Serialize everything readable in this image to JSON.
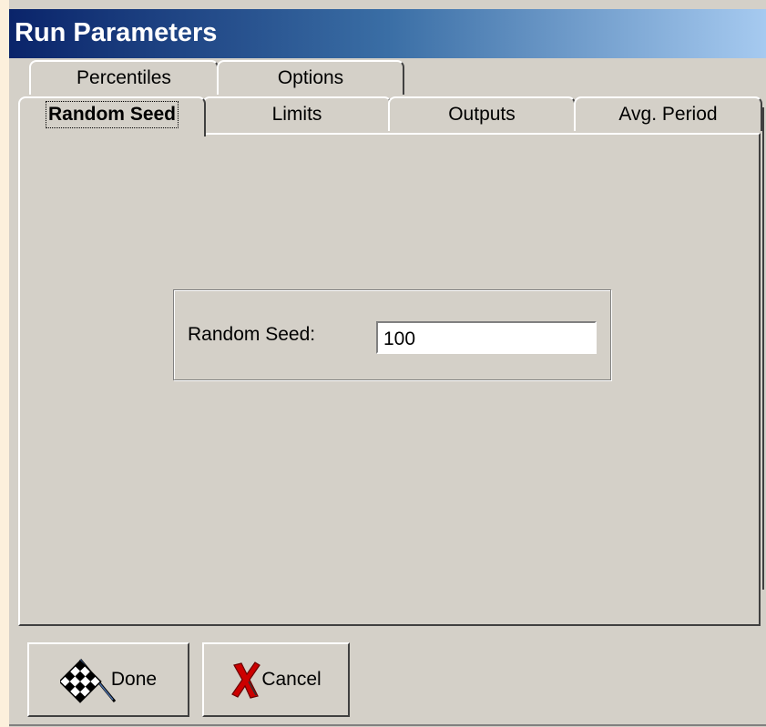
{
  "window": {
    "title": "Run Parameters"
  },
  "tabs": {
    "row_back": [
      {
        "label": "Percentiles"
      },
      {
        "label": "Options"
      }
    ],
    "row_front": [
      {
        "label": "Random Seed",
        "active": true
      },
      {
        "label": "Limits"
      },
      {
        "label": "Outputs"
      },
      {
        "label": "Avg. Period"
      }
    ]
  },
  "random_seed": {
    "label": "Random Seed:",
    "value": "100"
  },
  "buttons": {
    "done": {
      "label": "Done",
      "icon": "checkered-flag-icon"
    },
    "cancel": {
      "label": "Cancel",
      "icon": "red-x-icon"
    }
  },
  "colors": {
    "face": "#d4d0c8",
    "title_start": "#0a246a",
    "title_end": "#a6caf0",
    "cancel_x": "#cc0000"
  }
}
